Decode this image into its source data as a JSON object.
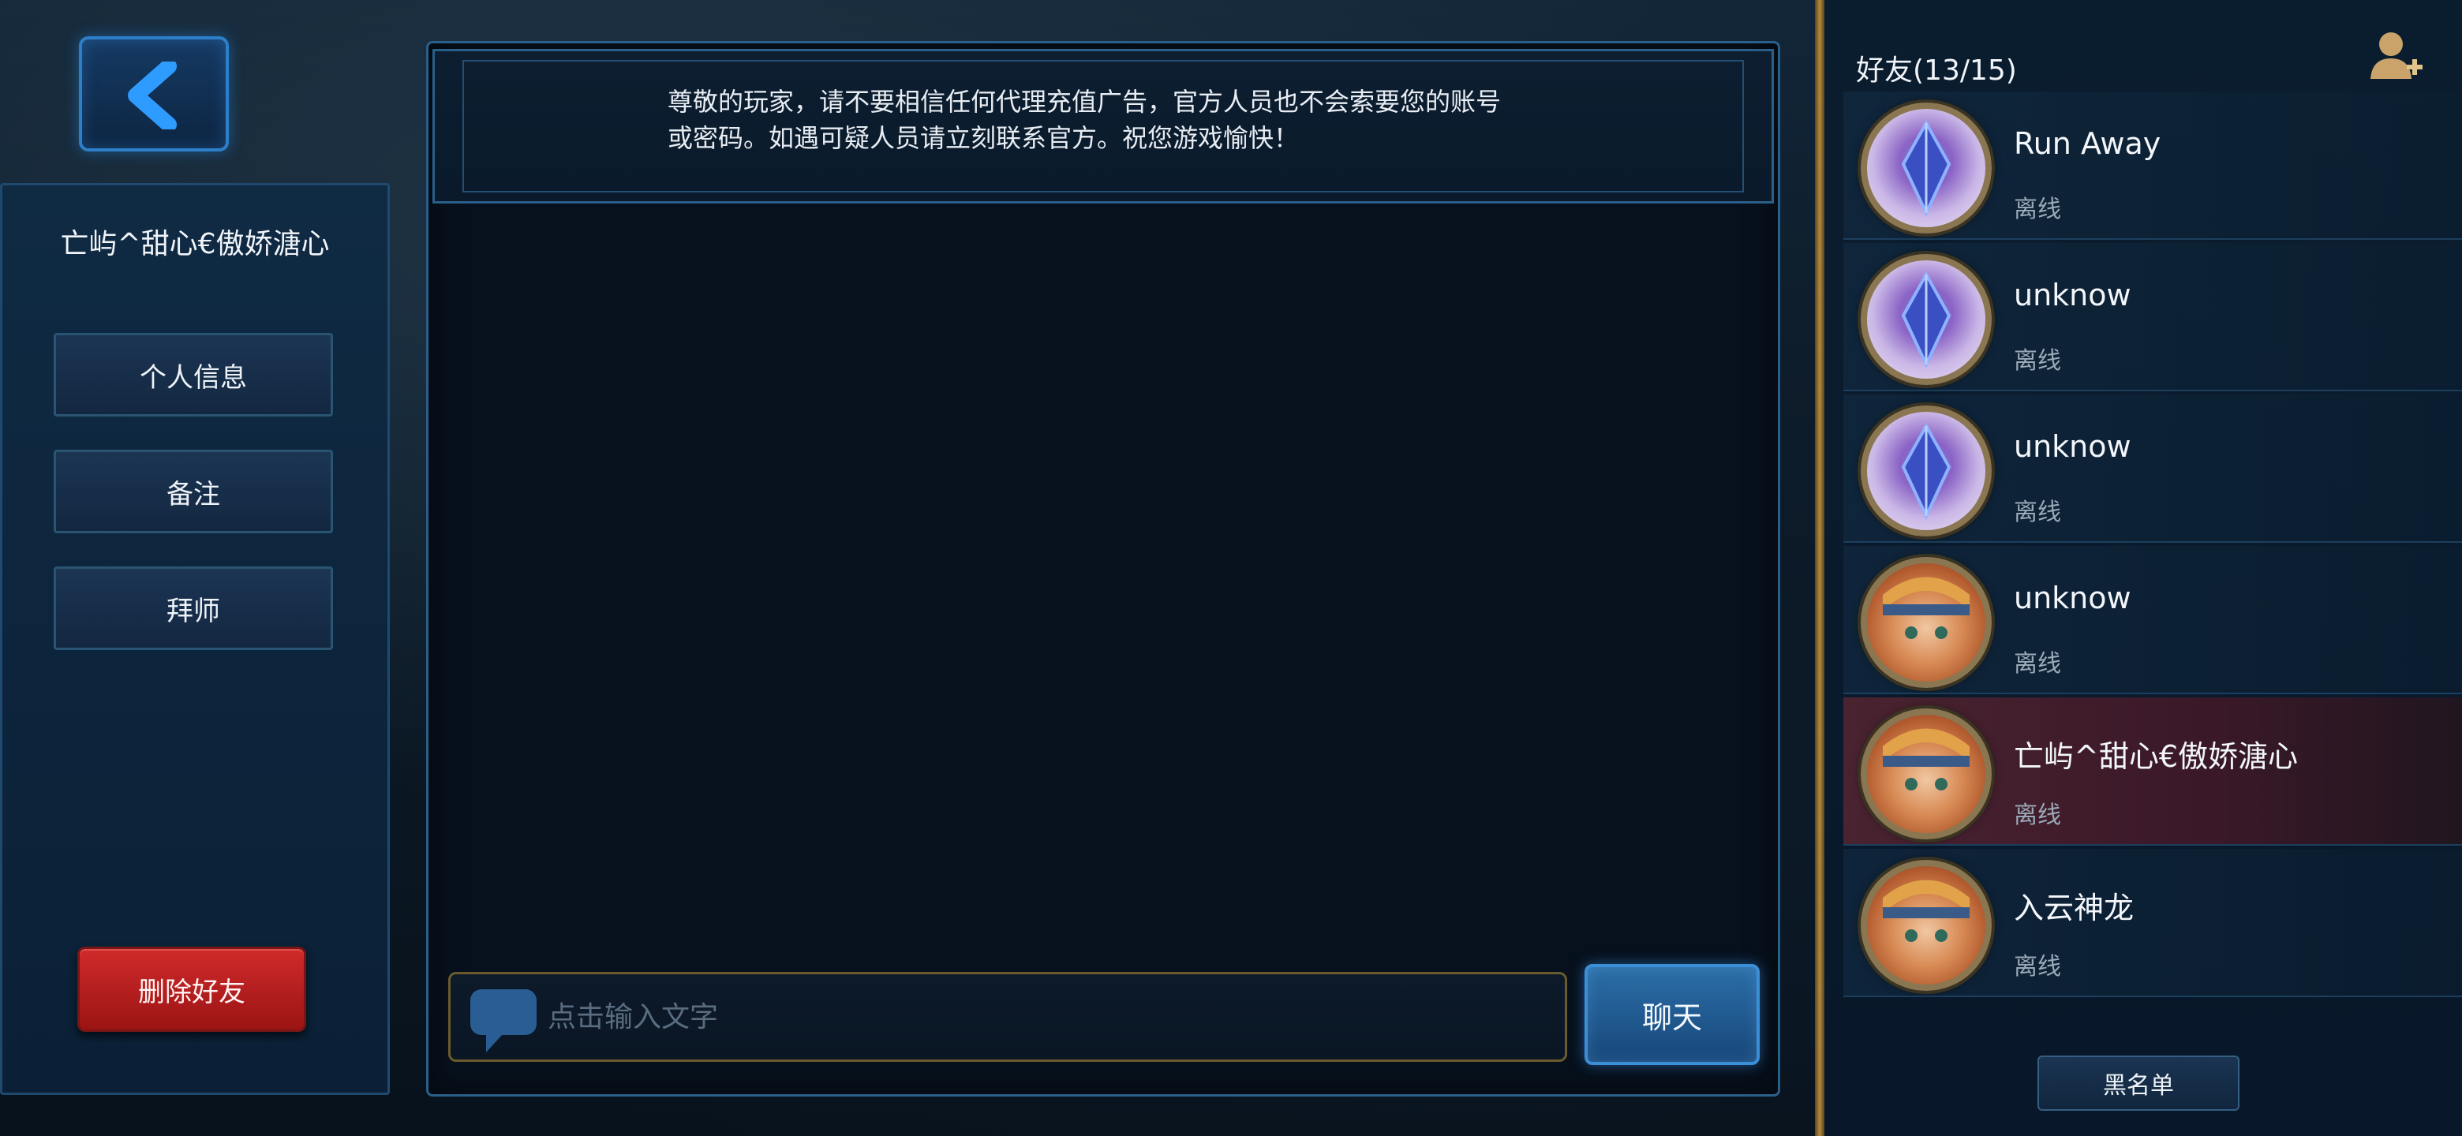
{
  "left_panel": {
    "profile_name": "亡屿^甜心€傲娇溏心",
    "buttons": [
      "个人信息",
      "备注",
      "拜师"
    ],
    "delete_label": "删除好友"
  },
  "chat": {
    "notice_line1": "尊敬的玩家，请不要相信任何代理充值广告，官方人员也不会索要您的账号",
    "notice_line2": "或密码。如遇可疑人员请立刻联系官方。祝您游戏愉快！",
    "input_placeholder": "点击输入文字",
    "send_label": "聊天"
  },
  "friends": {
    "title": "好友(13/15)",
    "items": [
      {
        "name": "Run Away",
        "status": "离线",
        "avatar": "crystal"
      },
      {
        "name": "unknow",
        "status": "离线",
        "avatar": "crystal"
      },
      {
        "name": "unknow",
        "status": "离线",
        "avatar": "crystal"
      },
      {
        "name": "unknow",
        "status": "离线",
        "avatar": "hero"
      },
      {
        "name": "亡屿^甜心€傲娇溏心",
        "status": "离线",
        "avatar": "hero",
        "selected": true
      },
      {
        "name": "入云神龙",
        "status": "离线",
        "avatar": "hero"
      }
    ],
    "blacklist_label": "黑名单"
  },
  "icons": {
    "back": "chevron-left-icon",
    "add_friend": "add-friend-icon",
    "chat_bubble": "chat-bubble-icon"
  },
  "colors": {
    "accent_blue": "#2d7fc9",
    "delete_red": "#d02a2a",
    "gold": "#b58a3c",
    "selected_row": "#4a2330"
  }
}
